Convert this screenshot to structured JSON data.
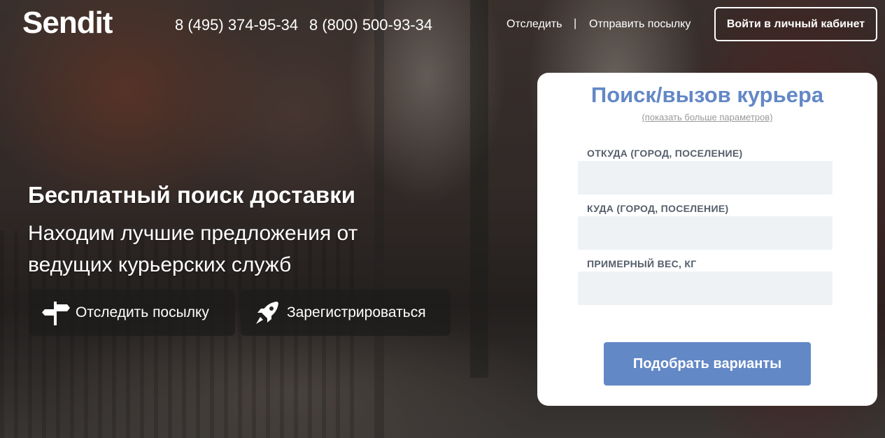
{
  "header": {
    "logo": "Sendit",
    "phones": [
      "8 (495) 374-95-34",
      "8 (800) 500-93-34"
    ],
    "nav": {
      "track": "Отследить",
      "separator": "|",
      "send": "Отправить посылку"
    },
    "login_button": "Войти в личный кабинет"
  },
  "hero": {
    "title": "Бесплатный поиск доставки",
    "subtitle": "Находим лучшие предложения от ведущих курьерских служб",
    "buttons": [
      {
        "label": "Отследить посылку",
        "icon": "signpost-icon"
      },
      {
        "label": "Зарегистрироваться",
        "icon": "rocket-icon"
      }
    ]
  },
  "search_form": {
    "title": "Поиск/вызов курьера",
    "more_params_link": "(показать больше параметров)",
    "fields": [
      {
        "label": "ОТКУДА (ГОРОД, ПОСЕЛЕНИЕ)",
        "value": ""
      },
      {
        "label": "КУДА (ГОРОД, ПОСЕЛЕНИЕ)",
        "value": ""
      },
      {
        "label": "ПРИМЕРНЫЙ ВЕС, КГ",
        "value": ""
      }
    ],
    "submit_button": "Подобрать варианты"
  },
  "colors": {
    "accent": "#6388c6",
    "input_bg": "#eff2f5"
  }
}
